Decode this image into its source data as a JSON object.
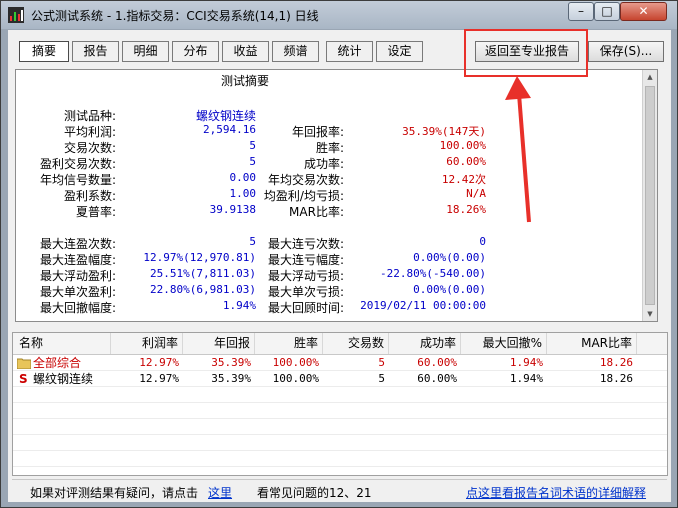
{
  "window": {
    "title": "公式测试系统 - 1.指标交易：CCI交易系统(14,1) 日线",
    "controls": {
      "minimize": "–",
      "maximize": "□",
      "close": "✕"
    }
  },
  "tabs": [
    "摘要",
    "报告",
    "明细",
    "分布",
    "收益",
    "频谱",
    "统计",
    "设定"
  ],
  "buttons": {
    "pro_report": "返回至专业报告",
    "save": "保存(S)..."
  },
  "summary": {
    "title": "测试摘要",
    "left": [
      {
        "label": "测试品种:",
        "value": "螺纹钢连续",
        "color": "blue"
      },
      {
        "label": "平均利润:",
        "value": "2,594.16",
        "color": "blue"
      },
      {
        "label": "交易次数:",
        "value": "5",
        "color": "blue"
      },
      {
        "label": "盈利交易次数:",
        "value": "5",
        "color": "blue"
      },
      {
        "label": "年均信号数量:",
        "value": "0.00",
        "color": "blue"
      },
      {
        "label": "盈利系数:",
        "value": "1.00",
        "color": "blue"
      },
      {
        "label": "夏普率:",
        "value": "39.9138",
        "color": "blue"
      }
    ],
    "right": [
      {
        "label": "年回报率:",
        "value": "35.39%(147天)",
        "color": "red"
      },
      {
        "label": "胜率:",
        "value": "100.00%",
        "color": "red"
      },
      {
        "label": "成功率:",
        "value": "60.00%",
        "color": "red"
      },
      {
        "label": "年均交易次数:",
        "value": "12.42次",
        "color": "red"
      },
      {
        "label": "均盈利/均亏损:",
        "value": "N/A",
        "color": "red"
      },
      {
        "label": "MAR比率:",
        "value": "18.26%",
        "color": "red"
      }
    ],
    "left2": [
      {
        "label": "最大连盈次数:",
        "value": "5",
        "color": "blue"
      },
      {
        "label": "最大连盈幅度:",
        "value": "12.97%(12,970.81)",
        "color": "blue"
      },
      {
        "label": "最大浮动盈利:",
        "value": "25.51%(7,811.03)",
        "color": "blue"
      },
      {
        "label": "最大单次盈利:",
        "value": "22.80%(6,981.03)",
        "color": "blue"
      },
      {
        "label": "最大回撤幅度:",
        "value": "1.94%",
        "color": "blue"
      }
    ],
    "right2": [
      {
        "label": "最大连亏次数:",
        "value": "0",
        "color": "blue"
      },
      {
        "label": "最大连亏幅度:",
        "value": "0.00%(0.00)",
        "color": "blue"
      },
      {
        "label": "最大浮动亏损:",
        "value": "-22.80%(-540.00)",
        "color": "blue"
      },
      {
        "label": "最大单次亏损:",
        "value": "0.00%(0.00)",
        "color": "blue"
      },
      {
        "label": "最大回顾时间:",
        "value": "2019/02/11 00:00:00",
        "color": "blue"
      }
    ]
  },
  "table": {
    "columns": [
      "名称",
      "利润率",
      "年回报",
      "胜率",
      "交易数",
      "成功率",
      "最大回撤%",
      "MAR比率"
    ],
    "rows": [
      {
        "icon": "folder-icon",
        "name": "全部综合",
        "cells": [
          "12.97%",
          "35.39%",
          "100.00%",
          "5",
          "60.00%",
          "1.94%",
          "18.26"
        ]
      },
      {
        "icon": "s-icon",
        "name": "螺纹钢连续",
        "cells": [
          "12.97%",
          "35.39%",
          "100.00%",
          "5",
          "60.00%",
          "1.94%",
          "18.26"
        ]
      }
    ]
  },
  "footer": {
    "text1": "如果对评测结果有疑问，请点击",
    "link1": "这里",
    "text2": "看常见问题的12、21",
    "link2": "点这里看报告名词术语的详细解释"
  },
  "colors": {
    "highlight": "#e8302a",
    "blue_text": "#0000c8",
    "red_text": "#c80000",
    "link": "#0033cc"
  }
}
